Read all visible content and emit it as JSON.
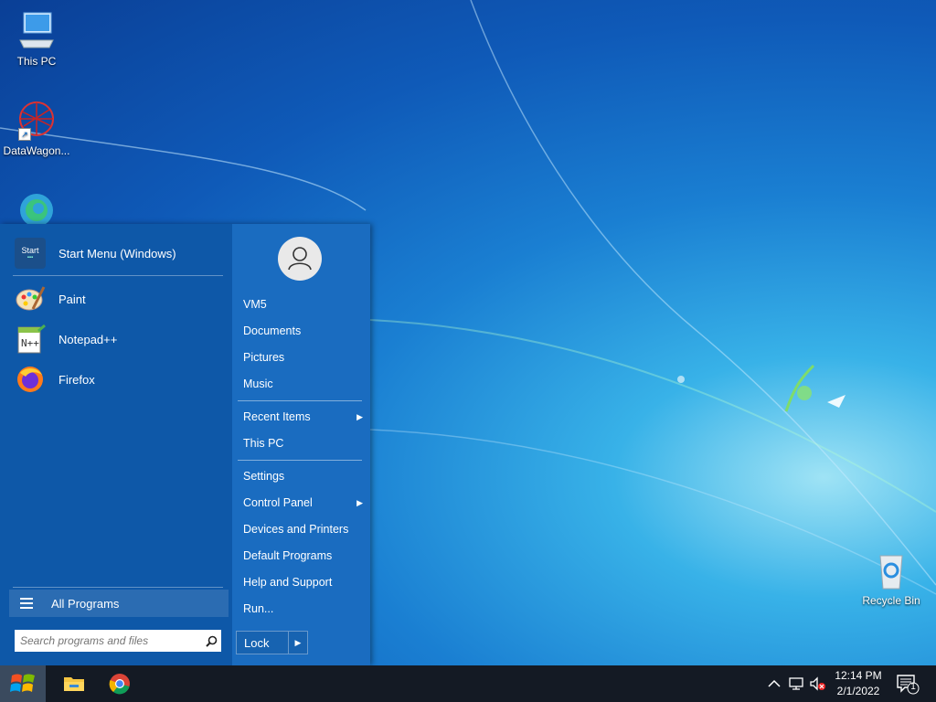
{
  "desktop": {
    "icons": [
      {
        "label": "This PC",
        "icon": "computer-icon"
      },
      {
        "label": "DataWagon...",
        "icon": "datawagon-icon"
      },
      {
        "label": "",
        "icon": "edge-icon"
      },
      {
        "label": "Recycle Bin",
        "icon": "recycle-bin-icon"
      }
    ]
  },
  "start_menu": {
    "pinned": [
      {
        "label": "Start Menu (Windows)",
        "icon": "start-menu-app-icon"
      }
    ],
    "recent_programs": [
      {
        "label": "Paint",
        "icon": "paint-icon"
      },
      {
        "label": "Notepad++",
        "icon": "notepadpp-icon"
      },
      {
        "label": "Firefox",
        "icon": "firefox-icon"
      }
    ],
    "start_icon_text": "Start",
    "all_programs_label": "All Programs",
    "search_placeholder": "Search programs and files",
    "right_items": [
      {
        "label": "VM5"
      },
      {
        "label": "Documents"
      },
      {
        "label": "Pictures"
      },
      {
        "label": "Music"
      },
      {
        "label": "Recent Items",
        "submenu": true
      },
      {
        "label": "This PC"
      },
      {
        "label": "Settings"
      },
      {
        "label": "Control Panel",
        "submenu": true
      },
      {
        "label": "Devices and Printers"
      },
      {
        "label": "Default Programs"
      },
      {
        "label": "Help and Support"
      },
      {
        "label": "Run..."
      }
    ],
    "lock_label": "Lock"
  },
  "taskbar": {
    "pinned": [
      "windows-start-icon",
      "file-explorer-icon",
      "chrome-icon"
    ],
    "tray_icons": [
      "chevron-up-icon",
      "network-icon",
      "volume-muted-icon"
    ],
    "time": "12:14 PM",
    "date": "2/1/2022",
    "notification_count": "1"
  },
  "colors": {
    "start_menu_left": "#0e58a8",
    "start_menu_right": "#1a6cc0",
    "taskbar": "#141a24"
  }
}
